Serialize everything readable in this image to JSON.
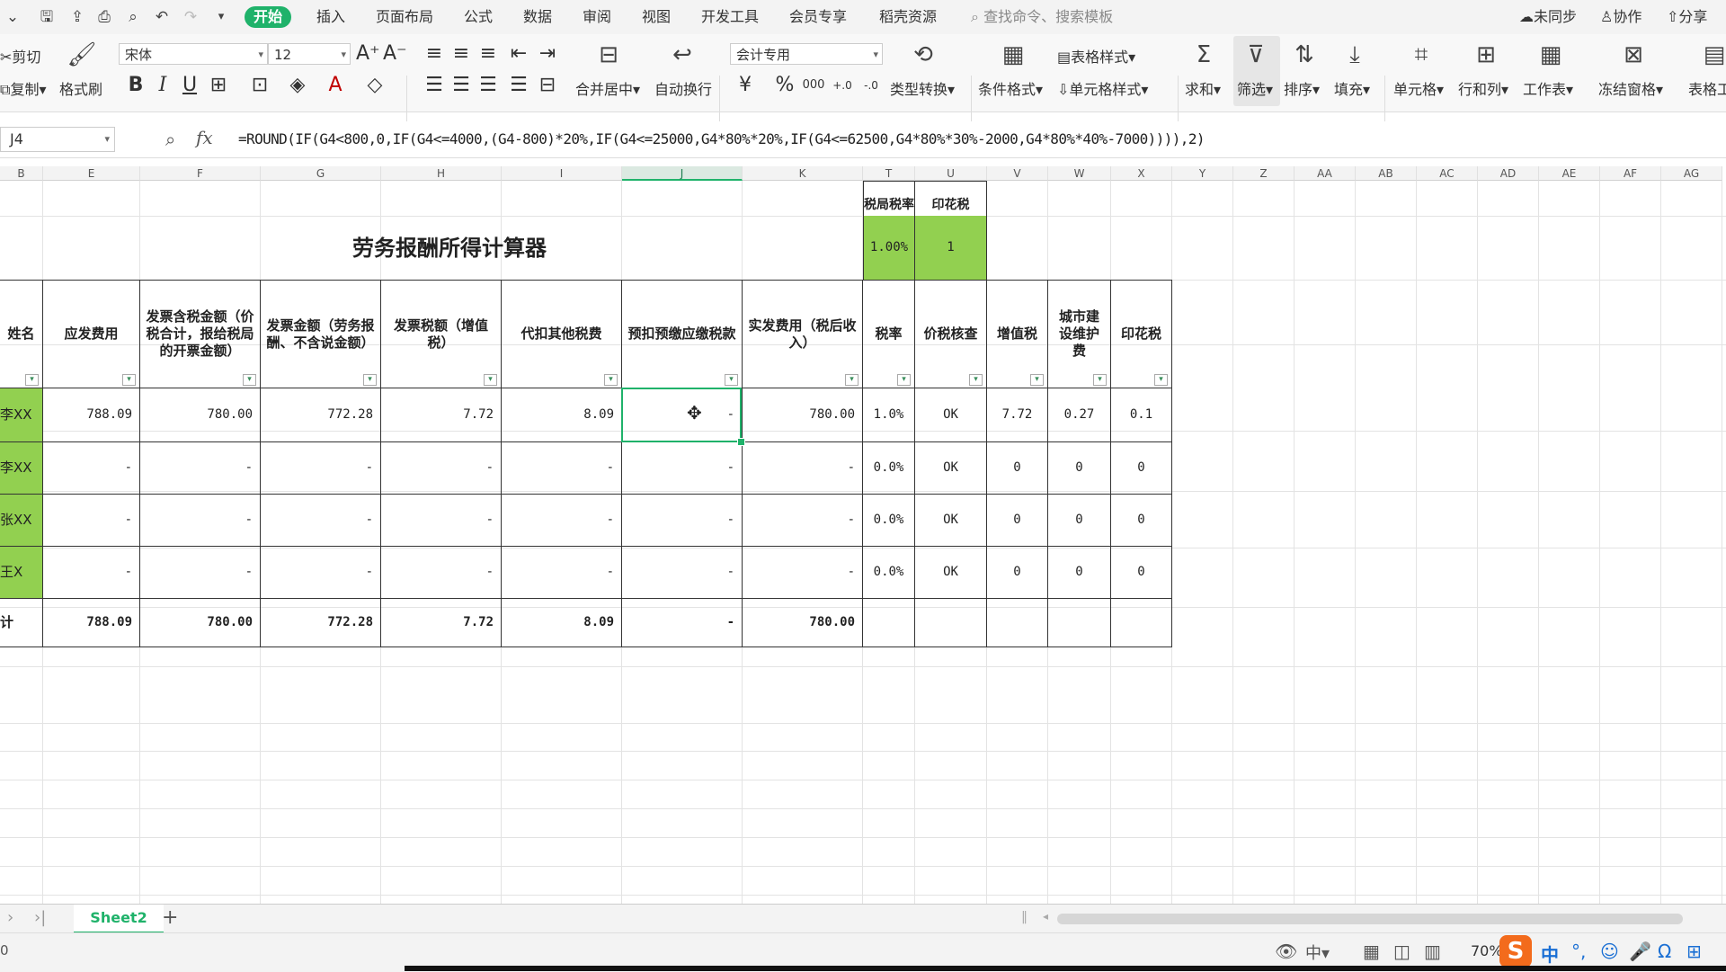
{
  "menu": {
    "tabs": [
      "开始",
      "插入",
      "页面布局",
      "公式",
      "数据",
      "审阅",
      "视图",
      "开发工具",
      "会员专享",
      "稻壳资源"
    ],
    "search_placeholder": "查找命令、搜索模板",
    "sync": "未同步",
    "collab": "协作",
    "share": "分享"
  },
  "ribbon": {
    "cut": "剪切",
    "copy": "复制",
    "format_painter": "格式刷",
    "font_name": "宋体",
    "font_size": "12",
    "number_format": "会计专用",
    "merge_center": "合并居中",
    "wrap_text": "自动换行",
    "type_convert": "类型转换",
    "cond_format": "条件格式",
    "table_style": "表格样式",
    "cell_style": "单元格样式",
    "sum": "求和",
    "filter": "筛选",
    "sort": "排序",
    "fill": "填充",
    "cells": "单元格",
    "rows_cols": "行和列",
    "worksheet": "工作表",
    "freeze": "冻结窗格",
    "table_tools": "表格工"
  },
  "formula_bar": {
    "name_box": "J4",
    "fx": "fx",
    "formula": "=ROUND(IF(G4<800,0,IF(G4<=4000,(G4-800)*20%,IF(G4<=25000,G4*80%*20%,IF(G4<=62500,G4*80%*30%-2000,G4*80%*40%-7000)))),2)"
  },
  "columns": [
    "B",
    "E",
    "F",
    "G",
    "H",
    "I",
    "J",
    "K",
    "T",
    "U",
    "V",
    "W",
    "X",
    "Y",
    "Z",
    "AA",
    "AB",
    "AC",
    "AD",
    "AE",
    "AF",
    "AG"
  ],
  "sheet": {
    "title": "劳务报酬所得计算器",
    "side_header_t": "税局税率",
    "side_header_u": "印花税",
    "side_value_t": "1.00%",
    "side_value_u": "1",
    "headers": [
      "姓名",
      "应发费用",
      "发票含税金额（价税合计，报给税局的开票金额）",
      "发票金额（劳务报酬、不含说金额）",
      "发票税额（增值税）",
      "代扣其他税费",
      "预扣预缴应缴税款",
      "实发费用（税后收入）",
      "税率",
      "价税核查",
      "增值税",
      "城市建设维护费",
      "印花税"
    ],
    "rows": [
      [
        "李XX",
        "788.09",
        "780.00",
        "772.28",
        "7.72",
        "8.09",
        "-",
        "780.00",
        "1.0%",
        "OK",
        "7.72",
        "0.27",
        "0.1"
      ],
      [
        "李XX",
        "-",
        "-",
        "-",
        "-",
        "-",
        "-",
        "-",
        "0.0%",
        "OK",
        "0",
        "0",
        "0"
      ],
      [
        "张XX",
        "-",
        "-",
        "-",
        "-",
        "-",
        "-",
        "-",
        "0.0%",
        "OK",
        "0",
        "0",
        "0"
      ],
      [
        "王X",
        "-",
        "-",
        "-",
        "-",
        "-",
        "-",
        "-",
        "0.0%",
        "OK",
        "0",
        "0",
        "0"
      ]
    ],
    "total_row": [
      "计",
      "788.09",
      "780.00",
      "772.28",
      "7.72",
      "8.09",
      "-",
      "780.00",
      "",
      "",
      "",
      "",
      ""
    ]
  },
  "tabs": {
    "sheet_name": "Sheet2",
    "add": "+"
  },
  "status": {
    "zoom": "70%",
    "left_text": "0",
    "ime": "中"
  }
}
